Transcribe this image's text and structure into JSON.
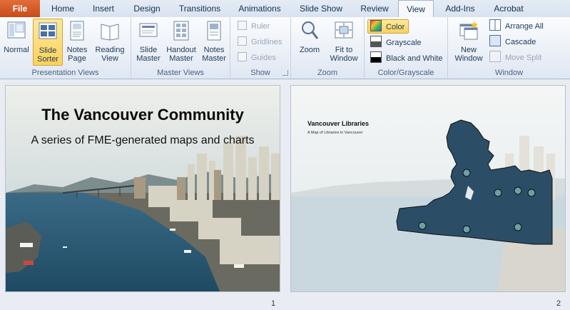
{
  "tabs": [
    {
      "label": "File"
    },
    {
      "label": "Home"
    },
    {
      "label": "Insert"
    },
    {
      "label": "Design"
    },
    {
      "label": "Transitions"
    },
    {
      "label": "Animations"
    },
    {
      "label": "Slide Show"
    },
    {
      "label": "Review"
    },
    {
      "label": "View"
    },
    {
      "label": "Add-Ins"
    },
    {
      "label": "Acrobat"
    }
  ],
  "ribbon": {
    "presentation_views": {
      "label": "Presentation Views",
      "buttons": [
        "Normal",
        "Slide Sorter",
        "Notes Page",
        "Reading View"
      ]
    },
    "master_views": {
      "label": "Master Views",
      "buttons": [
        "Slide Master",
        "Handout Master",
        "Notes Master"
      ]
    },
    "show": {
      "label": "Show",
      "items": [
        "Ruler",
        "Gridlines",
        "Guides"
      ]
    },
    "zoom": {
      "label": "Zoom",
      "buttons": [
        "Zoom",
        "Fit to Window"
      ]
    },
    "color": {
      "label": "Color/Grayscale",
      "items": [
        "Color",
        "Grayscale",
        "Black and White"
      ]
    },
    "window": {
      "label": "Window",
      "new_window": "New Window",
      "items": [
        "Arrange All",
        "Cascade",
        "Move Split"
      ]
    }
  },
  "slides": [
    {
      "number": "1",
      "title": "The Vancouver  Community",
      "subtitle": "A series of FME-generated  maps and charts"
    },
    {
      "number": "2",
      "title": "Vancouver Libraries",
      "subtitle": "A Map of Libraries in Vancouver"
    }
  ],
  "colors": {
    "accent_file": "#d65d2b",
    "selected": "#fbd25b",
    "map_fill": "#2c4d66"
  }
}
